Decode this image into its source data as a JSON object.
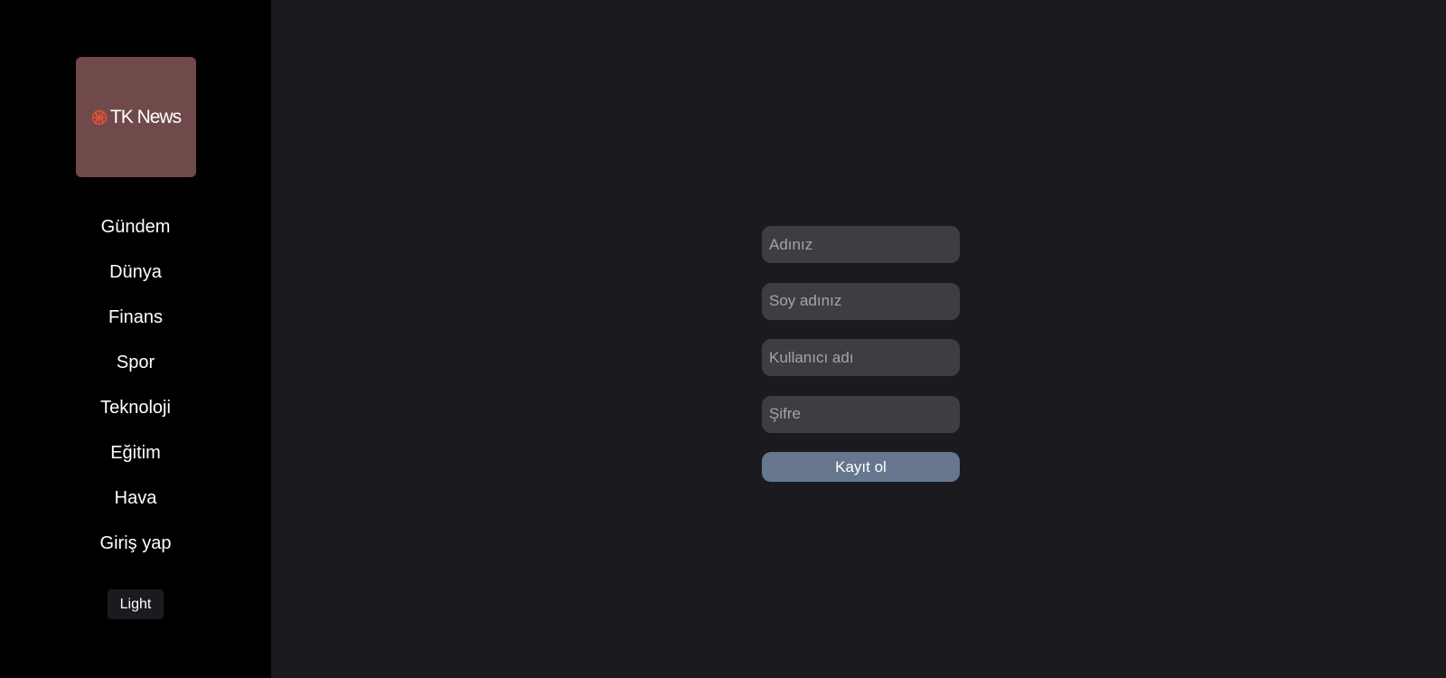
{
  "brand": {
    "logo_text": "TK News",
    "logo_bg": "#704a4a",
    "logo_mark_color": "#e0503c"
  },
  "sidebar": {
    "items": [
      {
        "label": "Gündem"
      },
      {
        "label": "Dünya"
      },
      {
        "label": "Finans"
      },
      {
        "label": "Spor"
      },
      {
        "label": "Teknoloji"
      },
      {
        "label": "Eğitim"
      },
      {
        "label": "Hava"
      },
      {
        "label": "Giriş yap"
      }
    ],
    "theme_toggle_label": "Light"
  },
  "form": {
    "first_name": {
      "value": "",
      "placeholder": "Adınız"
    },
    "last_name": {
      "value": "",
      "placeholder": "Soy adınız"
    },
    "username": {
      "value": "",
      "placeholder": "Kullanıcı adı"
    },
    "password": {
      "value": "",
      "placeholder": "Şifre"
    },
    "submit_label": "Kayıt ol"
  },
  "colors": {
    "sidebar_bg": "#000000",
    "main_bg": "#1b1a1f",
    "input_bg": "#3e3d44",
    "button_bg": "#66778e"
  }
}
